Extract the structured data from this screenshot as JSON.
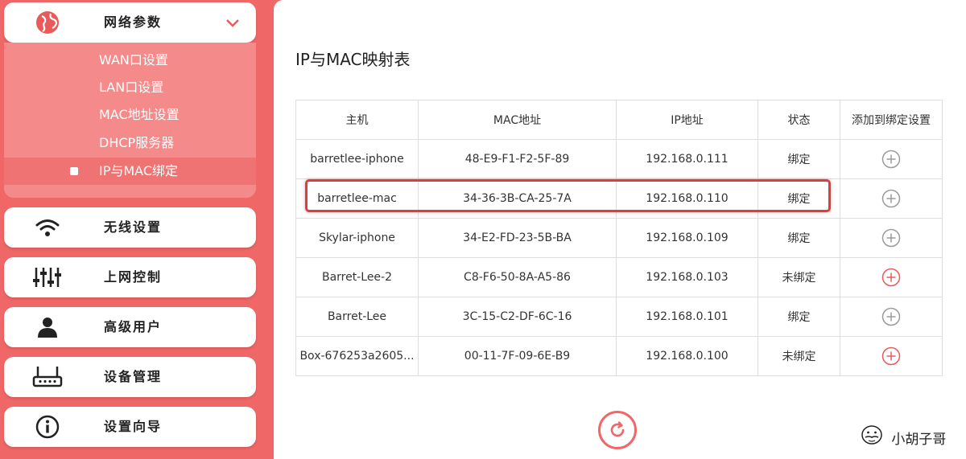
{
  "sidebar": {
    "network": {
      "label": "网络参数",
      "submenu": [
        {
          "label": "WAN口设置"
        },
        {
          "label": "LAN口设置"
        },
        {
          "label": "MAC地址设置"
        },
        {
          "label": "DHCP服务器"
        },
        {
          "label": "IP与MAC绑定"
        }
      ]
    },
    "items": [
      {
        "label": "无线设置",
        "icon": "wifi-icon"
      },
      {
        "label": "上网控制",
        "icon": "sliders-icon"
      },
      {
        "label": "高级用户",
        "icon": "user-icon"
      },
      {
        "label": "设备管理",
        "icon": "router-icon"
      },
      {
        "label": "设置向导",
        "icon": "info-icon"
      }
    ]
  },
  "main": {
    "title": "IP与MAC映射表",
    "table": {
      "headers": [
        "主机",
        "MAC地址",
        "IP地址",
        "状态",
        "添加到绑定设置"
      ],
      "rows": [
        {
          "host": "barretlee-iphone",
          "mac": "48-E9-F1-F2-5F-89",
          "ip": "192.168.0.111",
          "status": "绑定"
        },
        {
          "host": "barretlee-mac",
          "mac": "34-36-3B-CA-25-7A",
          "ip": "192.168.0.110",
          "status": "绑定"
        },
        {
          "host": "Skylar-iphone",
          "mac": "34-E2-FD-23-5B-BA",
          "ip": "192.168.0.109",
          "status": "绑定"
        },
        {
          "host": "Barret-Lee-2",
          "mac": "C8-F6-50-8A-A5-86",
          "ip": "192.168.0.103",
          "status": "未绑定"
        },
        {
          "host": "Barret-Lee",
          "mac": "3C-15-C2-DF-6C-16",
          "ip": "192.168.0.101",
          "status": "绑定"
        },
        {
          "host": "Box-676253a2605...",
          "mac": "00-11-7F-09-6E-B9",
          "ip": "192.168.0.100",
          "status": "未绑定"
        }
      ]
    }
  },
  "watermark": {
    "text": "小胡子哥"
  },
  "colors": {
    "accent": "#f06767",
    "submenu": "#f58a8a",
    "plus_bound": "#9a9a9a",
    "plus_unbound": "#e85a5a",
    "highlight": "#d84040"
  }
}
